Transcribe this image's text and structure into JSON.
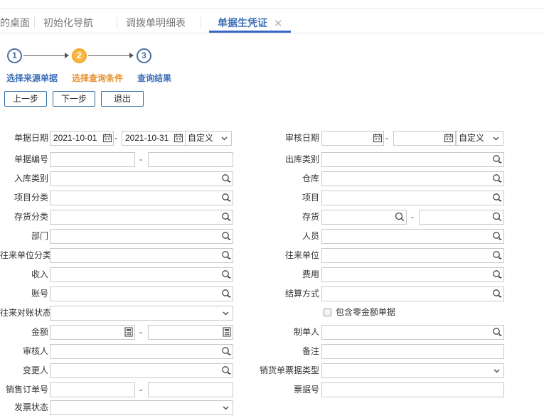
{
  "tabs": [
    {
      "label": "的桌面"
    },
    {
      "label": "初始化导航"
    },
    {
      "label": "调拨单明细表"
    },
    {
      "label": "单据生凭证"
    }
  ],
  "steps": [
    {
      "num": "1",
      "label": "选择来源单据"
    },
    {
      "num": "2",
      "label": "选择查询条件"
    },
    {
      "num": "3",
      "label": "查询结果"
    }
  ],
  "buttons": {
    "prev": "上一步",
    "next": "下一步",
    "exit": "退出"
  },
  "form": {
    "bill_date": {
      "label": "单据日期",
      "from": "2021-10-01",
      "to": "2021-10-31",
      "range": "自定义"
    },
    "audit_date": {
      "label": "审核日期",
      "from": "",
      "to": "",
      "range": "自定义"
    },
    "bill_no": {
      "label": "单据编号"
    },
    "out_type": {
      "label": "出库类别"
    },
    "in_type": {
      "label": "入库类别"
    },
    "warehouse": {
      "label": "仓库"
    },
    "project_class": {
      "label": "项目分类"
    },
    "project": {
      "label": "项目"
    },
    "inventory_class": {
      "label": "存货分类"
    },
    "inventory": {
      "label": "存货"
    },
    "department": {
      "label": "部门"
    },
    "staff": {
      "label": "人员"
    },
    "partner_class": {
      "label": "往来单位分类"
    },
    "partner": {
      "label": "往来单位"
    },
    "income": {
      "label": "收入"
    },
    "expense": {
      "label": "费用"
    },
    "account": {
      "label": "账号"
    },
    "settlement": {
      "label": "结算方式"
    },
    "reconcile_status": {
      "label": "往来对账状态"
    },
    "include_zero": {
      "label": "包含零金额单据"
    },
    "amount": {
      "label": "金额"
    },
    "creator": {
      "label": "制单人"
    },
    "auditor": {
      "label": "审核人"
    },
    "remark": {
      "label": "备注"
    },
    "modifier": {
      "label": "变更人"
    },
    "sales_bill_type": {
      "label": "销货单票据类型"
    },
    "sales_order_no": {
      "label": "销售订单号"
    },
    "ticket_no": {
      "label": "票据号"
    },
    "invoice_status": {
      "label": "发票状态"
    }
  }
}
